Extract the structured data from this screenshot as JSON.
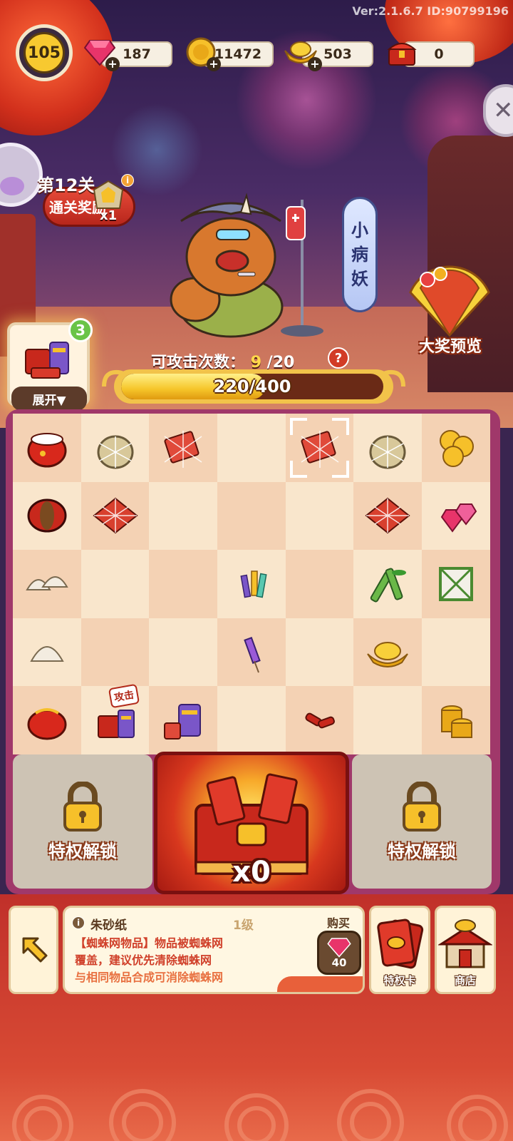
{
  "version_text": "Ver:2.1.6.7 ID:90799196",
  "player": {
    "level": "105"
  },
  "resources": {
    "gems": "187",
    "coins": "11472",
    "gold_ingots": "503",
    "chests": "0"
  },
  "stage": {
    "title": "第12关",
    "reward_label": "通关奖励",
    "reward_count": "x1"
  },
  "boss": {
    "name_chars": [
      "小",
      "病",
      "妖"
    ],
    "attack_label": "可攻击次数：",
    "attacks_left": "9",
    "attacks_total": "/20",
    "hp_text": "220/400",
    "hp_fraction": 0.55
  },
  "grand_prize_label": "大奖预览",
  "collection": {
    "badge": "3",
    "expand_label": "展开▼"
  },
  "board": {
    "attack_tag": "攻击",
    "cells": [
      [
        "red-fur-coat",
        "webbed-bag",
        "webbed-red-paper",
        "empty",
        "webbed-red-paper-selected",
        "webbed-bag",
        "gold-coins"
      ],
      [
        "red-thread-spool",
        "webbed-red-paper-large",
        "empty",
        "empty",
        "empty",
        "webbed-red-paper-large",
        "pink-gems"
      ],
      [
        "dumplings-pair",
        "empty",
        "empty",
        "firework-rockets",
        "empty",
        "bamboo",
        "bamboo-lantern-frame"
      ],
      [
        "dumpling",
        "empty",
        "empty",
        "firework-rocket",
        "empty",
        "gold-ingot",
        "empty"
      ],
      [
        "red-coat-bundle",
        "firework-box-attack",
        "firework-box",
        "empty",
        "firecrackers",
        "empty",
        "coin-stack"
      ]
    ]
  },
  "locked_slot_label": "特权解锁",
  "chest": {
    "count": "x0"
  },
  "item_info": {
    "name": "朱砂纸",
    "level": "1级",
    "desc_line1": "【蜘蛛网物品】物品被蜘蛛网",
    "desc_line2": "覆盖，建议优先清除蜘蛛网",
    "desc_line3": "与相同物品合成可消除蜘蛛网",
    "buy_label": "购买",
    "buy_price": "40"
  },
  "buttons": {
    "privilege_card": "特权卡",
    "shop": "商店"
  },
  "colors": {
    "accent_red": "#c0302a",
    "gold": "#f6c62a",
    "gem": "#e03a6a",
    "board_light": "#f9e6cc",
    "board_dark": "#f4d2b4"
  }
}
